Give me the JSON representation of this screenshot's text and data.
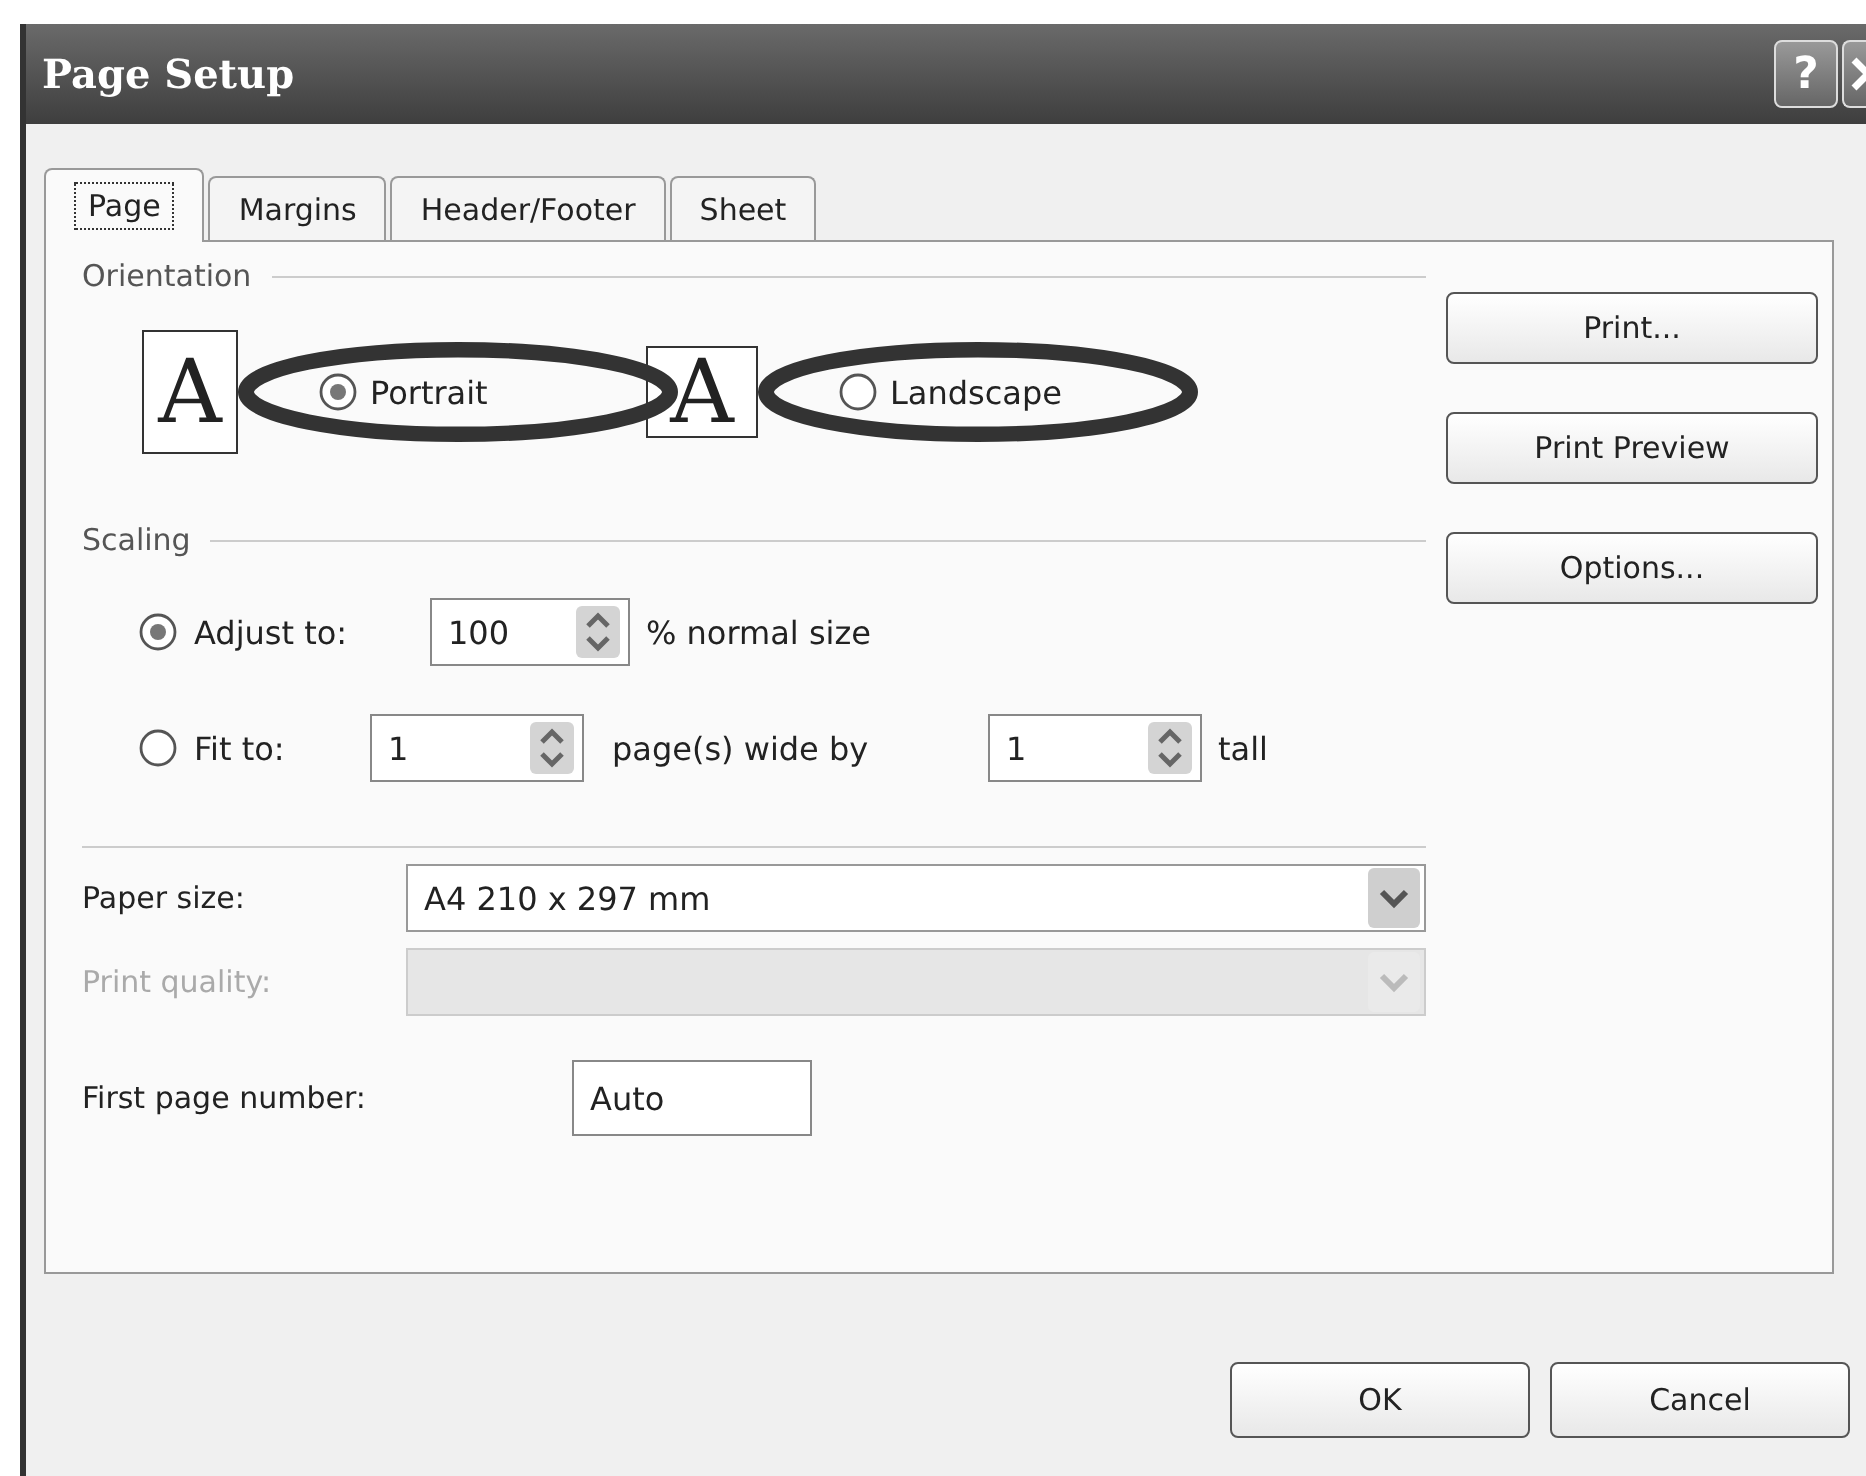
{
  "window": {
    "title": "Page Setup",
    "help": "?"
  },
  "tabs": [
    {
      "label": "Page",
      "selected": true
    },
    {
      "label": "Margins",
      "selected": false
    },
    {
      "label": "Header/Footer",
      "selected": false
    },
    {
      "label": "Sheet",
      "selected": false
    }
  ],
  "orientation": {
    "label": "Orientation",
    "options": [
      {
        "kind": "portrait",
        "glyph": "A",
        "label": "Portrait",
        "selected": true,
        "circled": true
      },
      {
        "kind": "landscape",
        "glyph": "A",
        "label": "Landscape",
        "selected": false,
        "circled": true
      }
    ]
  },
  "scaling": {
    "label": "Scaling",
    "adjust": {
      "label": "Adjust to:",
      "selected": true,
      "value": "100",
      "suffix": "% normal size"
    },
    "fit": {
      "label": "Fit to:",
      "selected": false,
      "wide_value": "1",
      "wide_suffix": "page(s) wide by",
      "tall_value": "1",
      "tall_suffix": "tall"
    }
  },
  "paper_size": {
    "label": "Paper size:",
    "value": "A4 210 x 297 mm",
    "disabled": false
  },
  "print_quality": {
    "label": "Print quality:",
    "disabled": true
  },
  "first_page_number": {
    "label": "First page number:",
    "value": "Auto"
  },
  "side_buttons": [
    "Print...",
    "Print Preview",
    "Options..."
  ],
  "footer_buttons": [
    "OK",
    "Cancel"
  ]
}
